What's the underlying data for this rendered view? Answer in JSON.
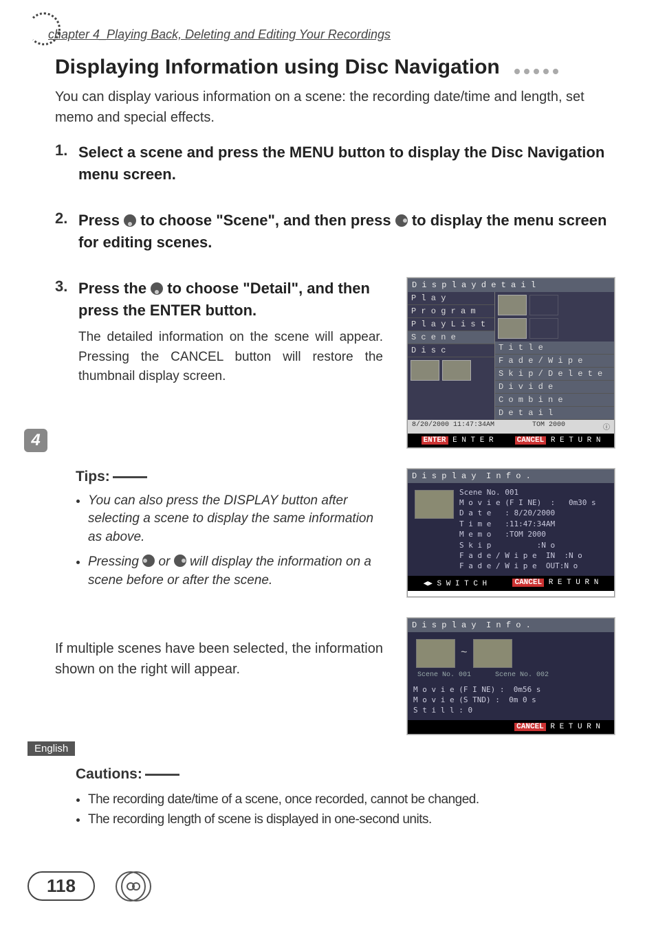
{
  "breadcrumb": "chapter 4_Playing Back, Deleting and Editing Your Recordings",
  "title": "Displaying Information using Disc Navigation",
  "intro": "You can display various information on a scene: the recording date/time and length, set memo and special effects.",
  "steps": {
    "s1": {
      "num": "1.",
      "head": "Select a scene and press the MENU button to display the Disc Navigation menu screen."
    },
    "s2": {
      "num": "2.",
      "head_a": "Press ",
      "head_b": " to choose \"Scene\", and then press ",
      "head_c": " to display the menu screen for editing scenes."
    },
    "s3": {
      "num": "3.",
      "head_a": "Press the ",
      "head_b": " to choose \"Detail\", and then press the ENTER button.",
      "sub": "The detailed information on the scene will appear. Pressing the CANCEL button will restore the thumbnail display screen."
    }
  },
  "panel_nav": {
    "title": "D i s p l a y d e t a i l",
    "left_items": [
      "P l a y",
      "P r o g r a m",
      "P l a y L i s t",
      "S c e n e",
      "D i s c"
    ],
    "right_items": [
      "T i t l e",
      "F a d e / W i p e",
      "S k i p / D e l e t e",
      "D i v i d e",
      "C o m b i n e",
      "D e t a i l"
    ],
    "status_left": "8/20/2000 11:47:34AM",
    "status_right": "TOM 2000",
    "footer_enter": "ENTER",
    "footer_enter_lbl": " E N T E R",
    "footer_cancel": "CANCEL",
    "footer_cancel_lbl": " R E T U R N"
  },
  "chapter_tab": "4",
  "tips_head": "Tips:",
  "tips": {
    "t1": "You can also press the DISPLAY button after selecting a scene to display the same information as above.",
    "t2_a": "Pressing ",
    "t2_b": " or ",
    "t2_c": " will display the information on a scene before or after the scene."
  },
  "panel_info": {
    "title": "D i s p l a y  I n f o .",
    "scene_no": "Scene No. 001",
    "lines": "M o v i e (F I NE)  :   0m30 s\nD a t e   : 8/20/2000\nT i m e   :11:47:34AM\nM e m o   :TOM 2000\nS k i p          :N o\nF a d e / W i p e  IN  :N o\nF a d e / W i p e  OUT:N o",
    "footer_switch": "◀▶ S W I T C H",
    "footer_cancel": "CANCEL",
    "footer_cancel_lbl": " R E T U R N"
  },
  "mid_note": "If multiple scenes have been selected, the information shown on the right will appear.",
  "panel_multi": {
    "title": "D i s p l a y  I n f o .",
    "scene_a": "Scene No. 001",
    "tilde": "~",
    "scene_b": "Scene No. 002",
    "lines": "M o v i e (F I NE) :  0m56 s\nM o v i e (S TND) :  0m 0 s\nS t i l l : 0",
    "footer_cancel": "CANCEL",
    "footer_cancel_lbl": " R E T U R N"
  },
  "lang": "English",
  "cautions_head": "Cautions:",
  "cautions": {
    "c1": "The recording date/time of a scene, once recorded, cannot be changed.",
    "c2": "The recording length of scene is displayed in one-second units."
  },
  "page_number": "118"
}
